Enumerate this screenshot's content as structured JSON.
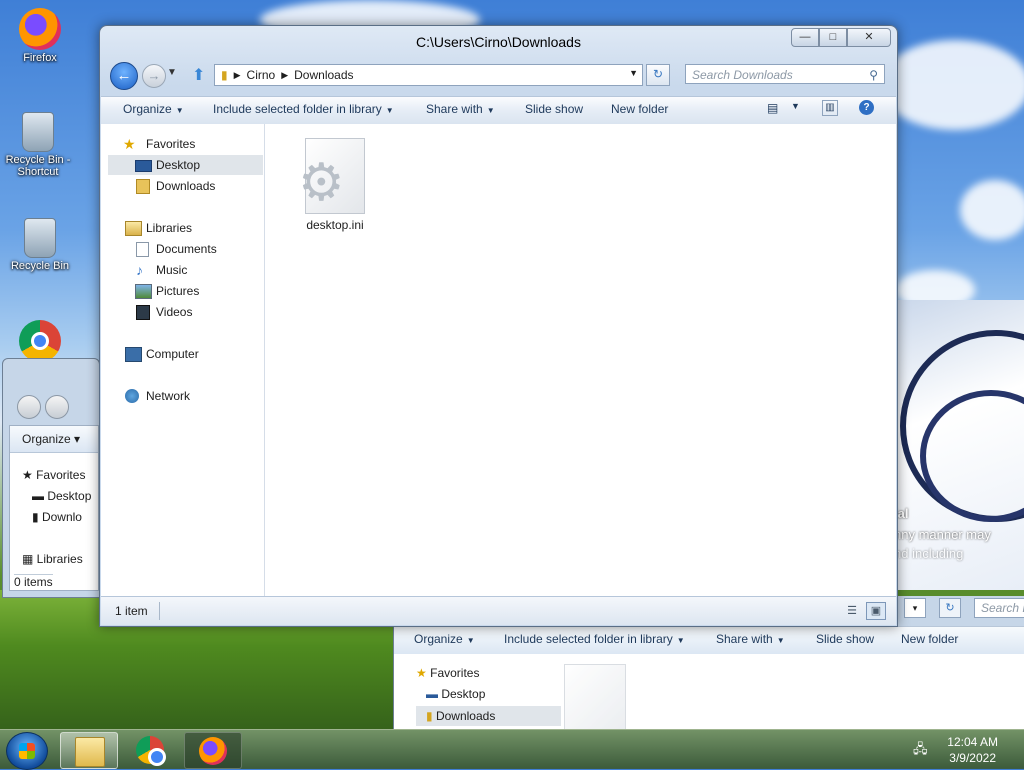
{
  "desktop": {
    "icons": [
      {
        "label": "Firefox"
      },
      {
        "label": "Recycle Bin - Shortcut"
      },
      {
        "label": "Recycle Bin"
      },
      {
        "label": "Chrome"
      }
    ],
    "overlay_lines": [
      "ial",
      "nny manner may",
      "nd including"
    ]
  },
  "window": {
    "title": "C:\\Users\\Cirno\\Downloads",
    "address": {
      "segments": [
        "Cirno",
        "Downloads"
      ]
    },
    "search_placeholder": "Search Downloads",
    "toolbar": {
      "organize": "Organize",
      "include": "Include selected folder in library",
      "share": "Share with",
      "slideshow": "Slide show",
      "newfolder": "New folder"
    },
    "nav": {
      "favorites": "Favorites",
      "desktop": "Desktop",
      "downloads": "Downloads",
      "libraries": "Libraries",
      "documents": "Documents",
      "music": "Music",
      "pictures": "Pictures",
      "videos": "Videos",
      "computer": "Computer",
      "network": "Network"
    },
    "files": [
      {
        "name": "desktop.ini"
      }
    ],
    "status": "1 item"
  },
  "back_window_left": {
    "organize": "Organize",
    "favorites": "Favorites",
    "desktop": "Desktop",
    "downloads": "Downlo",
    "libraries": "Libraries",
    "status": "0 items"
  },
  "back_window_bottom": {
    "search": "Search D",
    "organize": "Organize",
    "include": "Include selected folder in library",
    "share": "Share with",
    "slideshow": "Slide show",
    "newfolder": "New folder",
    "favorites": "Favorites",
    "desktop": "Desktop",
    "downloads": "Downloads"
  },
  "taskbar": {
    "time": "12:04 AM",
    "date": "3/9/2022"
  }
}
